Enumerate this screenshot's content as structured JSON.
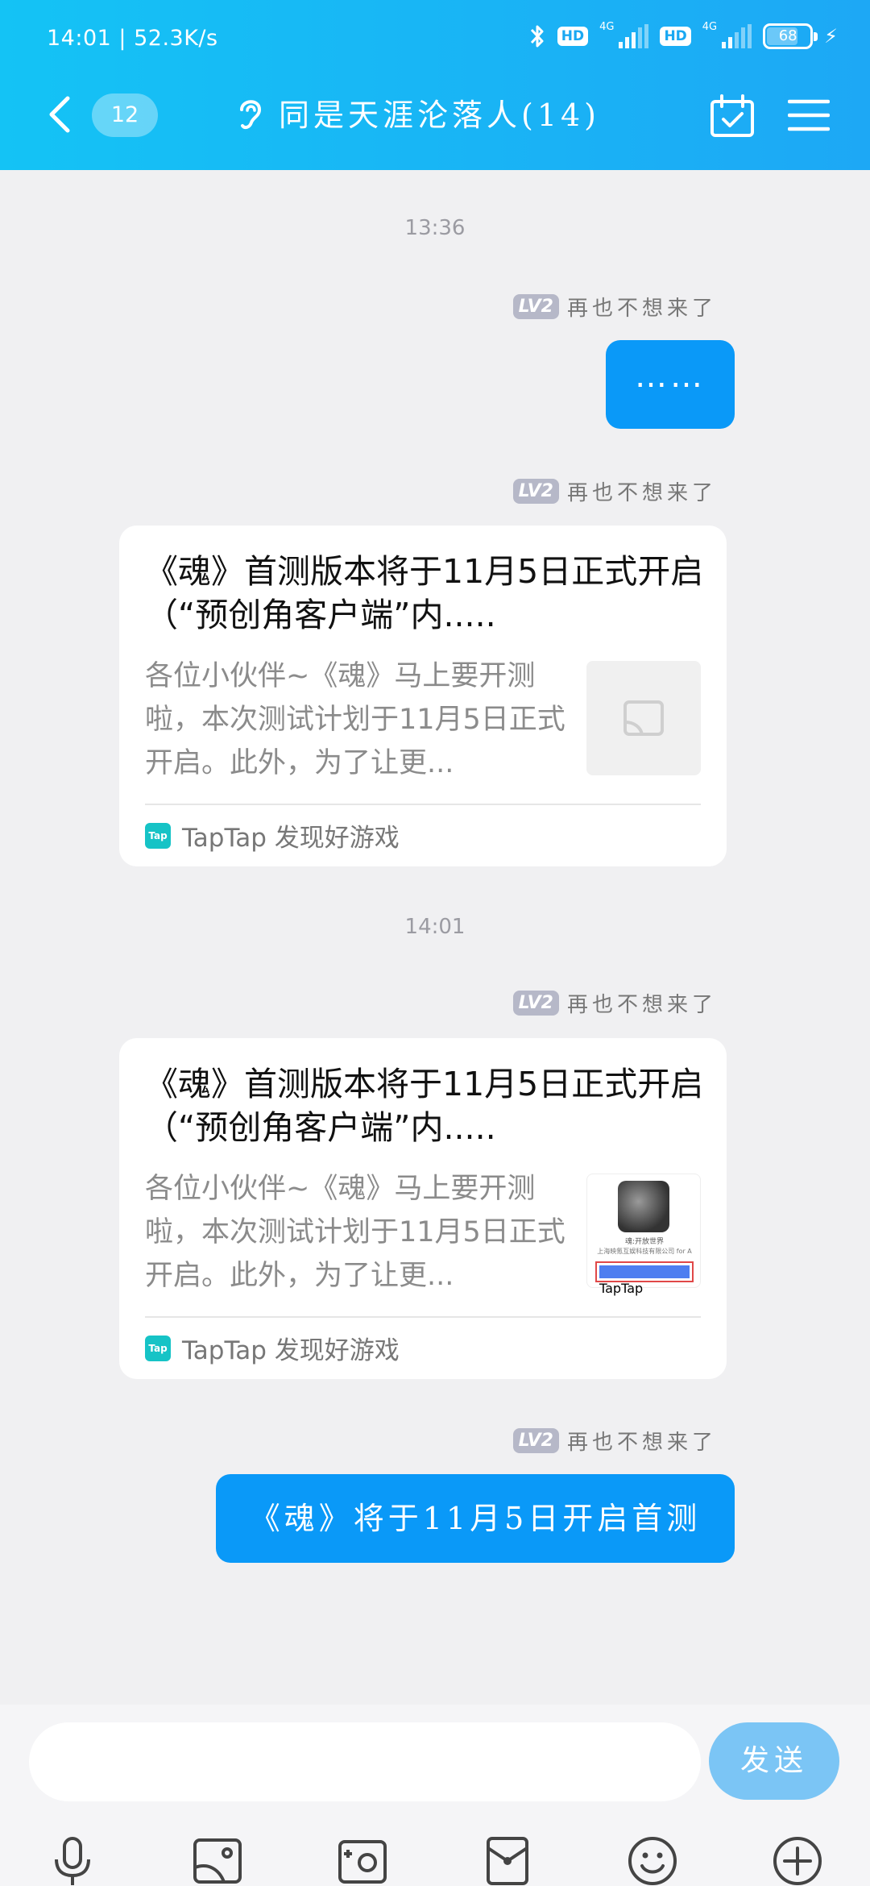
{
  "status_bar": {
    "time": "14:01",
    "speed": "52.3K/s",
    "hd1": "HD",
    "hd2": "HD",
    "net1": "4G",
    "net2": "4G",
    "battery": "68"
  },
  "header": {
    "unread_count": "12",
    "title": "同是天涯沦落人(14)"
  },
  "chat": {
    "time1": "13:36",
    "time2": "14:01",
    "sender_badge": "LV2",
    "sender_name": "再也不想来了",
    "msg1": "……",
    "card1": {
      "title": "《魂》首测版本将于11月5日正式开启（“预创角客户端”内.....",
      "desc": "各位小伙伴~《魂》马上要开测啦，本次测试计划于11月5日正式开启。此外，为了让更...",
      "source": "TapTap 发现好游戏",
      "tap_icon": "Tap"
    },
    "card2": {
      "title": "《魂》首测版本将于11月5日正式开启（“预创角客户端”内.....",
      "desc": "各位小伙伴~《魂》马上要开测啦，本次测试计划于11月5日正式开启。此外，为了让更...",
      "source": "TapTap 发现好游戏",
      "tap_icon": "Tap",
      "thumb_line1": "魂:开放世界",
      "thumb_line2": "上海映氪互娱科技有限公司 for A",
      "thumb_button": "View in TapTap"
    },
    "msg_last": "《魂》将于11月5日开启首测"
  },
  "input": {
    "placeholder": "",
    "send_label": "发送"
  },
  "colors": {
    "header_start": "#14c3f5",
    "header_end": "#1da8f5",
    "bubble": "#0a99f8",
    "send": "#7bc5f5"
  }
}
